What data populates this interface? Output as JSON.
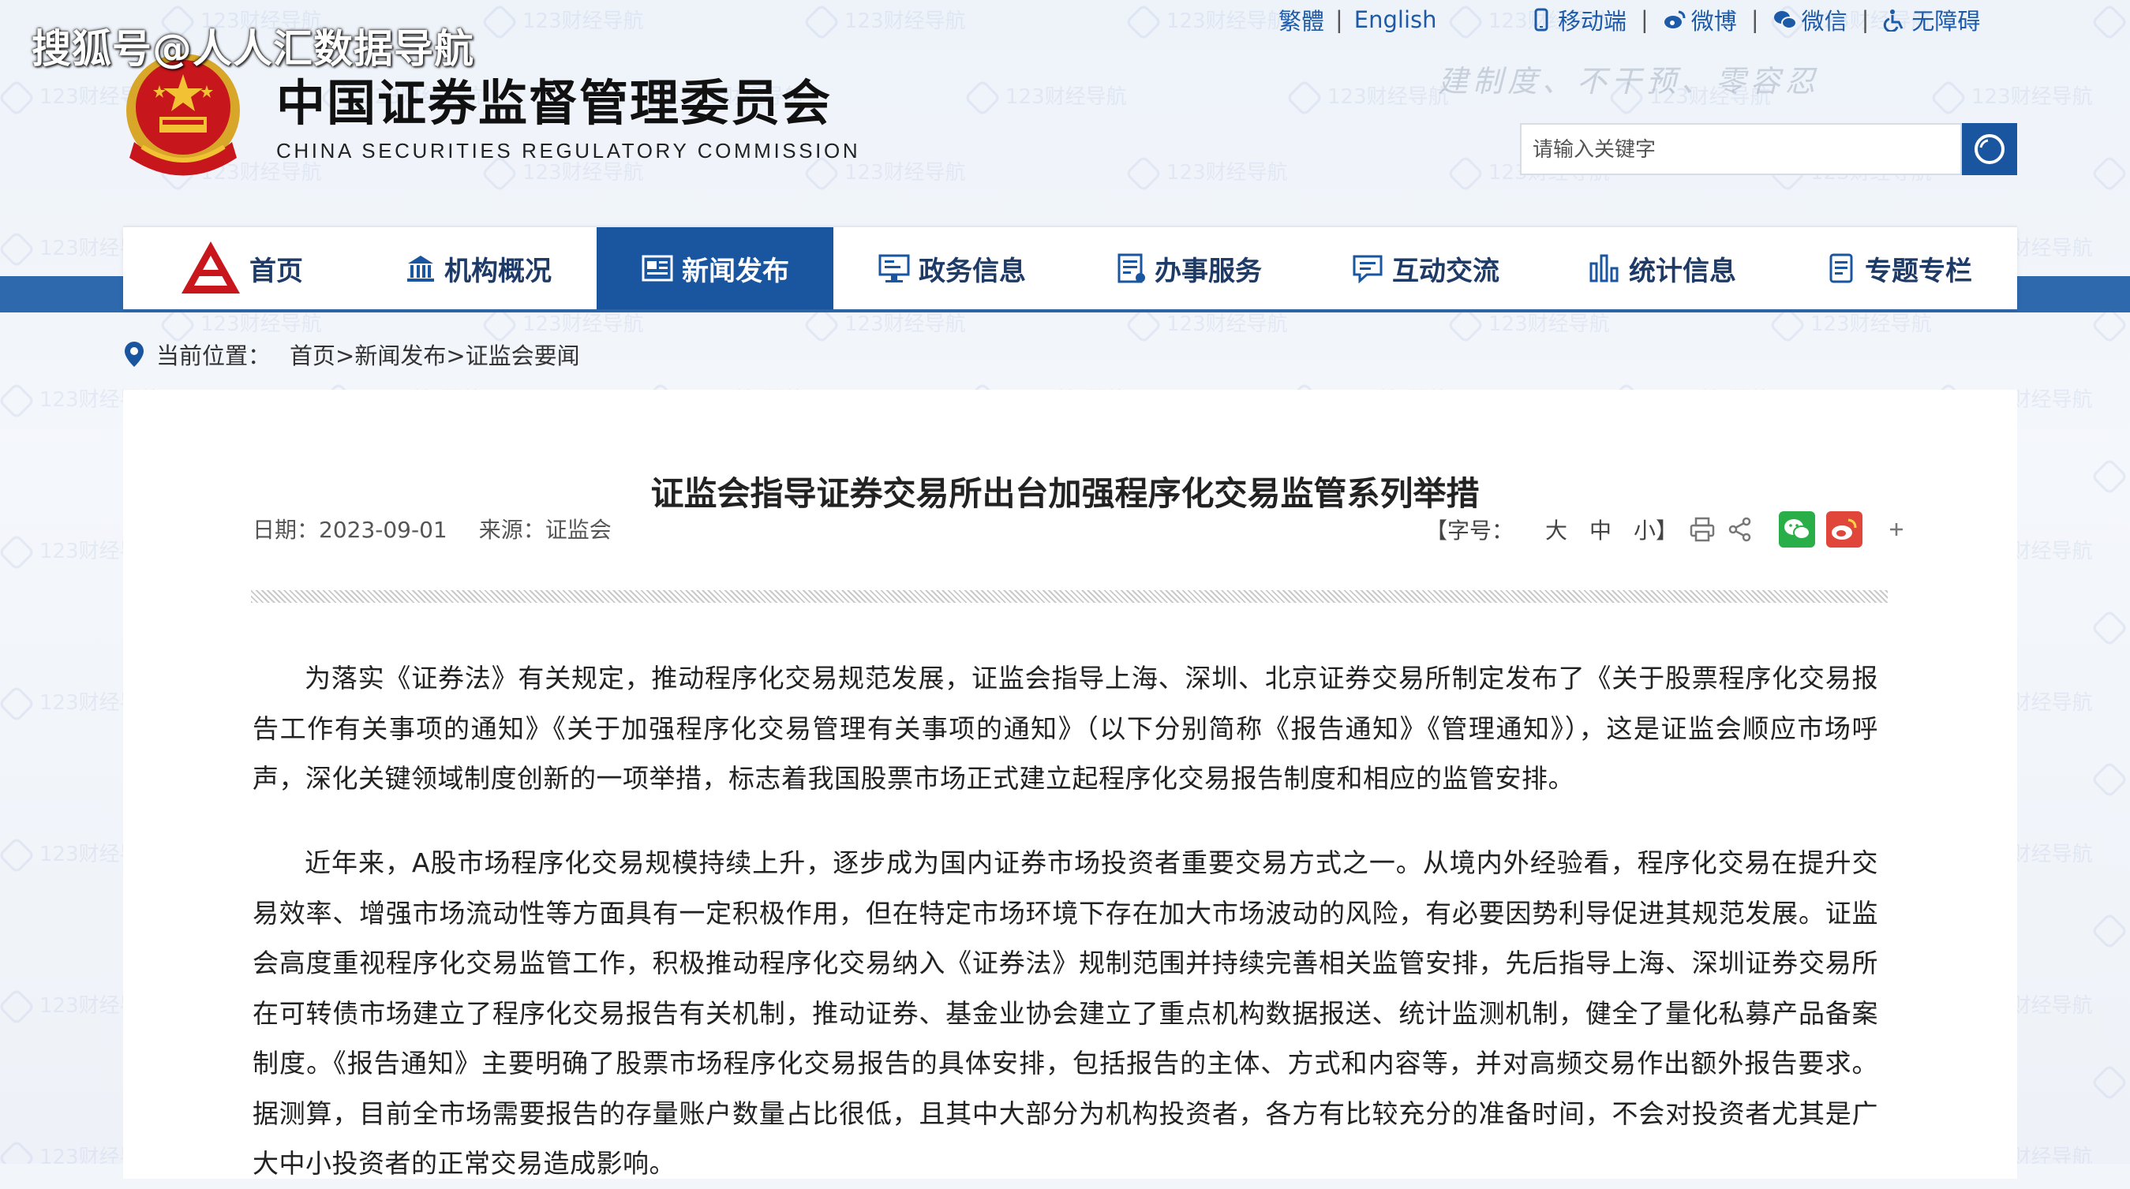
{
  "watermark": {
    "text": "123财经导航"
  },
  "overlay": {
    "source_mark": "搜狐号@人人汇数据导航"
  },
  "header": {
    "logo_cn": "中国证券监督管理委员会",
    "logo_en": "CHINA SECURITIES REGULATORY COMMISSION",
    "lang_traditional": "繁體",
    "lang_sep": "|",
    "lang_english": "English",
    "links": [
      {
        "icon": "mobile-icon",
        "label": "移动端"
      },
      {
        "icon": "weibo-icon",
        "label": "微博"
      },
      {
        "icon": "wechat-icon",
        "label": "微信"
      },
      {
        "icon": "accessibility-icon",
        "label": "无障碍"
      }
    ],
    "slogan": "建制度、不干预、零容忍",
    "search_placeholder": "请输入关键字"
  },
  "nav": {
    "items": [
      {
        "label": "首页",
        "icon": "home-logo-icon"
      },
      {
        "label": "机构概况",
        "icon": "building-icon"
      },
      {
        "label": "新闻发布",
        "icon": "news-icon",
        "active": true
      },
      {
        "label": "政务信息",
        "icon": "monitor-icon"
      },
      {
        "label": "办事服务",
        "icon": "service-icon"
      },
      {
        "label": "互动交流",
        "icon": "chat-icon"
      },
      {
        "label": "统计信息",
        "icon": "bar-chart-icon"
      },
      {
        "label": "专题专栏",
        "icon": "document-icon"
      }
    ]
  },
  "breadcrumb": {
    "prefix": "当前位置：",
    "path": "首页>新闻发布>证监会要闻"
  },
  "article": {
    "title": "证监会指导证券交易所出台加强程序化交易监管系列举措",
    "date": "日期：2023-09-01",
    "source": "来源：证监会",
    "font_size_label": "【字号：",
    "font_large": "大",
    "font_medium": "中",
    "font_small": "小】",
    "paragraphs": [
      "为落实《证券法》有关规定，推动程序化交易规范发展，证监会指导上海、深圳、北京证券交易所制定发布了《关于股票程序化交易报告工作有关事项的通知》《关于加强程序化交易管理有关事项的通知》（以下分别简称《报告通知》《管理通知》），这是证监会顺应市场呼声，深化关键领域制度创新的一项举措，标志着我国股票市场正式建立起程序化交易报告制度和相应的监管安排。",
      "近年来，A股市场程序化交易规模持续上升，逐步成为国内证券市场投资者重要交易方式之一。从境内外经验看，程序化交易在提升交易效率、增强市场流动性等方面具有一定积极作用，但在特定市场环境下存在加大市场波动的风险，有必要因势利导促进其规范发展。证监会高度重视程序化交易监管工作，积极推动程序化交易纳入《证券法》规制范围并持续完善相关监管安排，先后指导上海、深圳证券交易所在可转债市场建立了程序化交易报告有关机制，推动证券、基金业协会建立了重点机构数据报送、统计监测机制，健全了量化私募产品备案制度。《报告通知》主要明确了股票市场程序化交易报告的具体安排，包括报告的主体、方式和内容等，并对高频交易作出额外报告要求。据测算，目前全市场需要报告的存量账户数量占比很低，且其中大部分为机构投资者，各方有比较充分的准备时间，不会对投资者尤其是广大中小投资者的正常交易造成影响。"
    ]
  },
  "colors": {
    "brand_blue": "#1a56a0",
    "nav_band": "#2e68ad",
    "wechat_green": "#2aae47",
    "weibo_red": "#e0463a"
  }
}
